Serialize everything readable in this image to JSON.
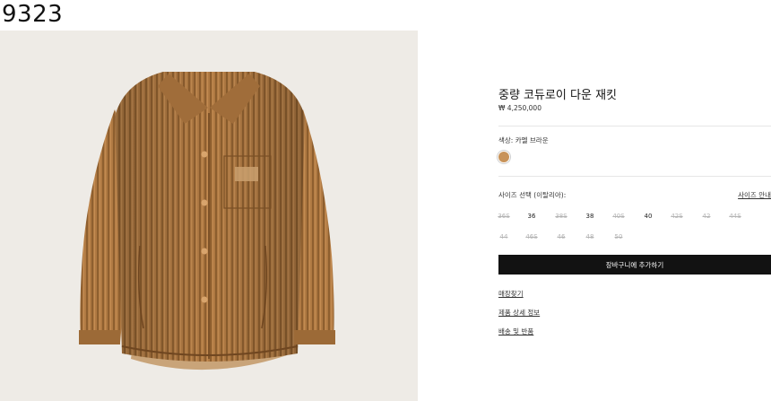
{
  "header": {
    "id_text": "9323"
  },
  "product": {
    "image_alt": "카멜 브라운 코듀로이 다운 재킷",
    "title": "중량 코듀로이 다운 재킷",
    "price": "₩ 4,250,000",
    "color_label": "색상: 카멜 브라운",
    "swatch_color": "#c8935a",
    "size_label": "사이즈 선택 (이탈리아):",
    "size_guide": "사이즈 안내",
    "sizes_row1": [
      {
        "label": "36S",
        "available": false
      },
      {
        "label": "36",
        "available": true
      },
      {
        "label": "38S",
        "available": false
      },
      {
        "label": "38",
        "available": true
      },
      {
        "label": "40S",
        "available": false
      },
      {
        "label": "40",
        "available": true
      },
      {
        "label": "42S",
        "available": false
      },
      {
        "label": "42",
        "available": false
      },
      {
        "label": "44S",
        "available": false
      }
    ],
    "sizes_row2": [
      {
        "label": "44",
        "available": false
      },
      {
        "label": "46S",
        "available": false
      },
      {
        "label": "46",
        "available": false
      },
      {
        "label": "48",
        "available": false
      },
      {
        "label": "50",
        "available": false
      }
    ],
    "add_to_cart": "장바구니에 추가하기",
    "links": [
      "매장찾기",
      "제품 상세 정보",
      "배송 및 반품"
    ]
  }
}
